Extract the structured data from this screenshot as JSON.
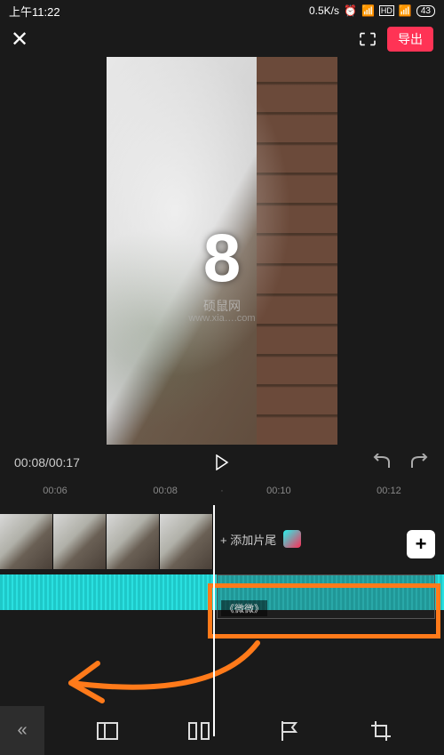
{
  "status": {
    "time": "上午11:22",
    "speed": "0.5K/s",
    "battery": "43"
  },
  "topbar": {
    "export_label": "导出"
  },
  "preview": {
    "countdown": "8",
    "watermark_main": "硕鼠网",
    "watermark_sub": "www.xia….com"
  },
  "playback": {
    "time_display": "00:08/00:17"
  },
  "ruler": {
    "t1": "00:06",
    "t2": "00:08",
    "t3": "00:10",
    "t4": "00:12"
  },
  "timeline": {
    "add_tail_label": "+ 添加片尾",
    "add_button_label": "+",
    "audio_name": "《微微》"
  }
}
